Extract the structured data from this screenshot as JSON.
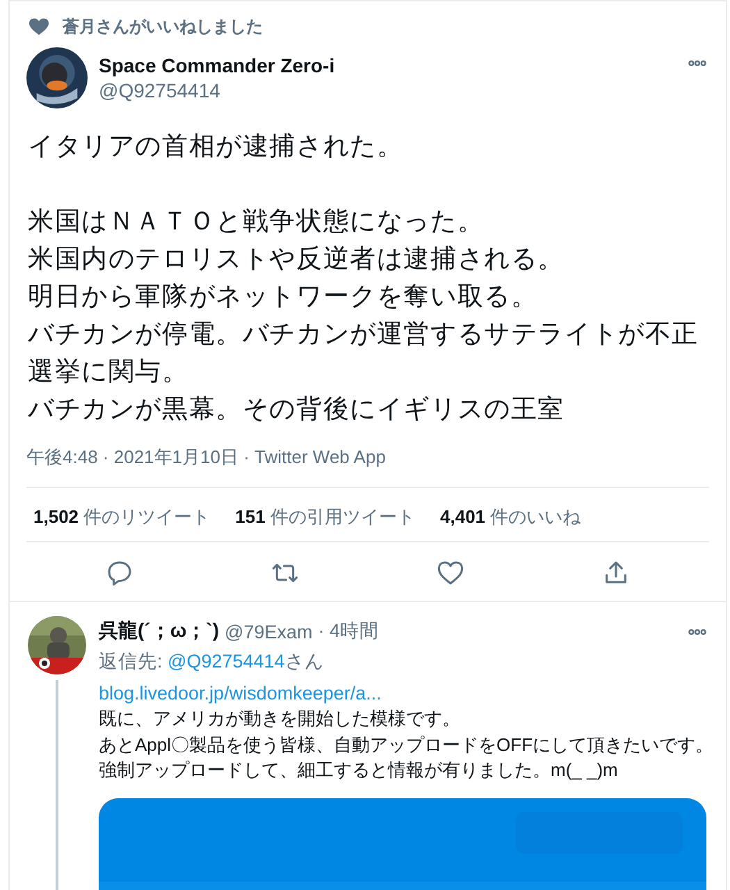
{
  "social_context": {
    "text": "蒼月さんがいいねしました"
  },
  "tweet": {
    "author": {
      "name": "Space Commander Zero-i",
      "handle": "@Q92754414"
    },
    "paragraphs": [
      [
        "イタリアの首相が逮捕された。"
      ],
      [
        "米国はＮＡＴＯと戦争状態になった。",
        "米国内のテロリストや反逆者は逮捕される。",
        "明日から軍隊がネットワークを奪い取る。",
        "バチカンが停電。バチカンが運営するサテライトが不正選挙に関与。",
        "バチカンが黒幕。その背後にイギリスの王室"
      ]
    ],
    "meta": "午後4:48 · 2021年1月10日 · Twitter Web App",
    "stats": [
      "**1,502** 件のリツイート",
      "**151** 件の引用ツイート",
      "**4,401** 件のいいね"
    ]
  },
  "reply": {
    "author": {
      "name": "呉龍(´；ω；`)",
      "handle": "@79Exam",
      "time": "· 4時間"
    },
    "reply_to_label": "返信先: ",
    "reply_to_handle": "@Q92754414",
    "reply_to_suffix": "さん",
    "link": "blog.livedoor.jp/wisdomkeeper/a...",
    "lines": [
      "既に、アメリカが動きを開始した模様です。",
      "あとAppl〇製品を使う皆様、自動アップロードをOFFにして頂きたいです。",
      "強制アップロードして、細工すると情報が有りました。m(_ _)m"
    ]
  }
}
